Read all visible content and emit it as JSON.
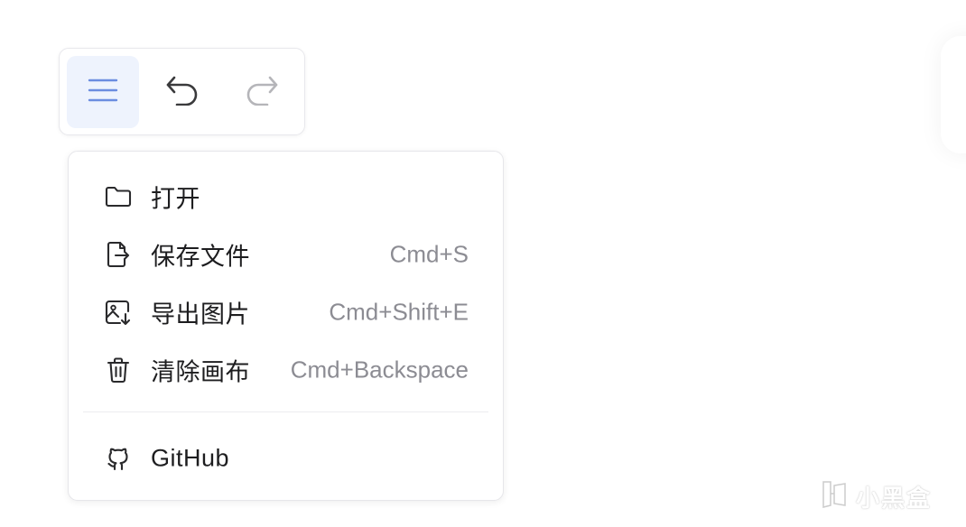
{
  "toolbar": {
    "menu_icon": "hamburger-icon",
    "undo_icon": "undo-icon",
    "redo_icon": "redo-icon",
    "colors": {
      "menu_active_bg": "#eef3fd",
      "menu_icon": "#6b8de0",
      "undo_enabled": "#3a3a3c",
      "redo_disabled": "#b5b5b9"
    }
  },
  "menu": {
    "items": [
      {
        "label": "打开",
        "shortcut": "",
        "icon": "folder-icon"
      },
      {
        "label": "保存文件",
        "shortcut": "Cmd+S",
        "icon": "file-export-icon"
      },
      {
        "label": "导出图片",
        "shortcut": "Cmd+Shift+E",
        "icon": "image-download-icon"
      },
      {
        "label": "清除画布",
        "shortcut": "Cmd+Backspace",
        "icon": "trash-icon"
      }
    ],
    "links": [
      {
        "label": "GitHub",
        "icon": "github-icon"
      }
    ]
  },
  "watermark": {
    "text": "小黑盒",
    "icon": "heybox-logo-icon"
  }
}
